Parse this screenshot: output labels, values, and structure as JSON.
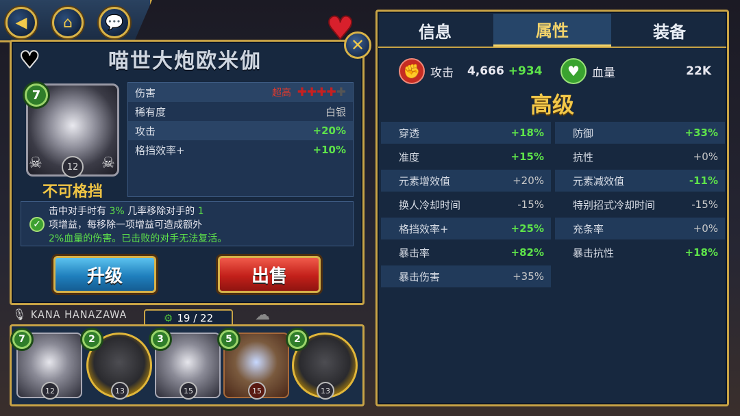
{
  "nav": {
    "back_icon": "back-arrow-icon",
    "home_icon": "home-icon",
    "chat_icon": "chat-icon"
  },
  "card": {
    "title": "喵世大炮欧米伽",
    "level": "7",
    "star_level": "12",
    "trait": "不可格挡",
    "stats": [
      {
        "label": "伤害",
        "prefix": "超高",
        "crosses_on": 4,
        "crosses_total": 5
      },
      {
        "label": "稀有度",
        "value": "白银"
      },
      {
        "label": "攻击",
        "value": "+20%"
      },
      {
        "label": "格挡效率+",
        "value": "+10%"
      }
    ],
    "ability": {
      "line1_a": "击中对手时有",
      "line1_pct": "3%",
      "line1_b": "几率移除对手的",
      "line1_num": "1",
      "line2": "项增益，每移除一项增益可造成额外",
      "line3": "2%血量的伤害。已击败的对手无法复活。"
    },
    "upgrade_label": "升级",
    "sell_label": "出售",
    "voice_actor": "KANA HANAZAWA",
    "collection_count": "19 / 22"
  },
  "tray": [
    {
      "level": "7",
      "stars": "12",
      "frame": "silver"
    },
    {
      "level": "2",
      "stars": "13",
      "frame": "gold"
    },
    {
      "level": "3",
      "stars": "15",
      "frame": "silver"
    },
    {
      "level": "5",
      "stars": "15",
      "frame": "bronze"
    },
    {
      "level": "2",
      "stars": "13",
      "frame": "gold"
    }
  ],
  "tabs": [
    "信息",
    "属性",
    "装备"
  ],
  "summary": {
    "attack_label": "攻击",
    "attack_base": "4,666",
    "attack_bonus": "+934",
    "hp_label": "血量",
    "hp_value": "22K"
  },
  "tier": "高级",
  "attributes": [
    {
      "label": "穿透",
      "value": "+18%",
      "green": true
    },
    {
      "label": "防御",
      "value": "+33%",
      "green": true
    },
    {
      "label": "准度",
      "value": "+15%",
      "green": true
    },
    {
      "label": "抗性",
      "value": "+0%",
      "green": false
    },
    {
      "label": "元素增效值",
      "value": "+20%",
      "green": false
    },
    {
      "label": "元素减效值",
      "value": "-11%",
      "green": true
    },
    {
      "label": "换人冷却时间",
      "value": "-15%",
      "green": false
    },
    {
      "label": "特别招式冷却时间",
      "value": "-15%",
      "green": false
    },
    {
      "label": "格挡效率+",
      "value": "+25%",
      "green": true
    },
    {
      "label": "充条率",
      "value": "+0%",
      "green": false
    },
    {
      "label": "暴击率",
      "value": "+82%",
      "green": true
    },
    {
      "label": "暴击抗性",
      "value": "+18%",
      "green": true
    },
    {
      "label": "暴击伤害",
      "value": "+35%",
      "green": false
    }
  ],
  "colors": {
    "gold_border": "#c9a446",
    "panel_bg": "#17283f",
    "green_value": "#5ee34a",
    "tier_gold": "#f2c84a"
  }
}
